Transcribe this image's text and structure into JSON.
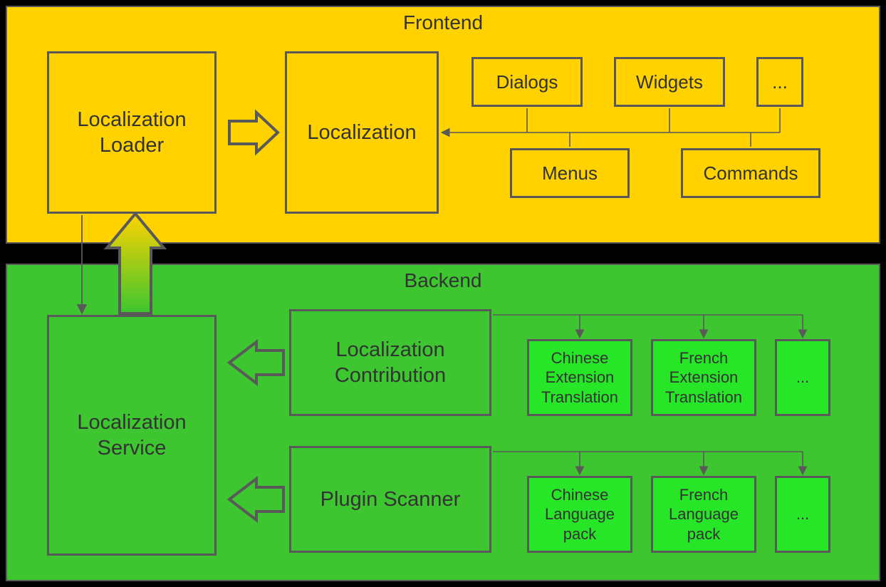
{
  "frontend": {
    "title": "Frontend",
    "loader": "Localization\nLoader",
    "localization": "Localization",
    "dialogs": "Dialogs",
    "widgets": "Widgets",
    "more": "...",
    "menus": "Menus",
    "commands": "Commands"
  },
  "backend": {
    "title": "Backend",
    "service": "Localization\nService",
    "contribution": "Localization\nContribution",
    "scanner": "Plugin Scanner",
    "zh_ext": "Chinese\nExtension\nTranslation",
    "fr_ext": "French\nExtension\nTranslation",
    "ext_more": "...",
    "zh_pack": "Chinese\nLanguage\npack",
    "fr_pack": "French\nLanguage\npack",
    "pack_more": "..."
  },
  "colors": {
    "frontend_bg": "#ffd200",
    "backend_bg": "#3dc62f",
    "bright_green": "#27e527",
    "stroke": "#595959"
  }
}
